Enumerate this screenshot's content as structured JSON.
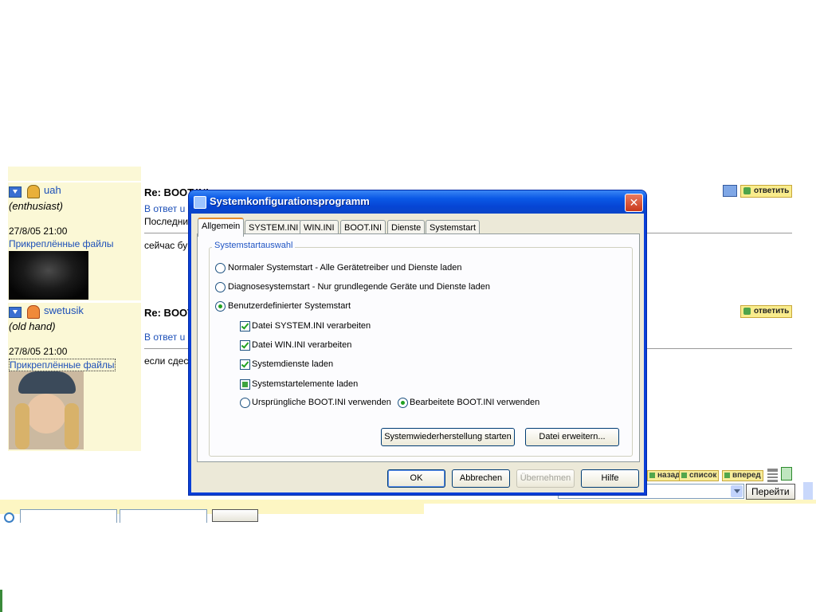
{
  "forum": {
    "posts": [
      {
        "username": "uah",
        "rank": "(enthusiast)",
        "date": "27/8/05 21:00",
        "files_label": "Прикреплённые файлы",
        "title": "Re: BOOT.INI",
        "reply": "В ответ u",
        "line1": "Последни",
        "text": "сейчас бу",
        "reply_button": "ответить"
      },
      {
        "username": "swetusik",
        "rank": "(old hand)",
        "date": "27/8/05 21:00",
        "files_label": "Прикреплённые файлы",
        "title": "Re: BOOT",
        "reply": "В ответ u",
        "text": "если сдес",
        "reply_button": "ответить"
      }
    ],
    "nav": {
      "back": "назад",
      "list": "список",
      "forward": "вперед"
    },
    "goto_button": "Перейти"
  },
  "dialog": {
    "title": "Systemkonfigurationsprogramm",
    "close": "✕",
    "tabs": [
      "Allgemein",
      "SYSTEM.INI",
      "WIN.INI",
      "BOOT.INI",
      "Dienste",
      "Systemstart"
    ],
    "active_tab": "Allgemein",
    "group_label": "Systemstartauswahl",
    "radio_options": [
      {
        "label": "Normaler Systemstart - Alle Gerätetreiber und Dienste laden",
        "selected": false
      },
      {
        "label": "Diagnosesystemstart - Nur grundlegende Geräte und Dienste laden",
        "selected": false
      },
      {
        "label": "Benutzerdefinierter Systemstart",
        "selected": true
      }
    ],
    "checkboxes": [
      {
        "label": "Datei SYSTEM.INI verarbeiten",
        "state": "checked"
      },
      {
        "label": "Datei WIN.INI verarbeiten",
        "state": "checked"
      },
      {
        "label": "Systemdienste laden",
        "state": "checked"
      },
      {
        "label": "Systemstartelemente laden",
        "state": "partial"
      }
    ],
    "boot_options": [
      {
        "label": "Ursprüngliche BOOT.INI verwenden",
        "selected": false
      },
      {
        "label": "Bearbeitete BOOT.INI verwenden",
        "selected": true
      }
    ],
    "restore_button": "Systemwiederherstellung starten",
    "extend_button": "Datei erweitern...",
    "ok": "OK",
    "cancel": "Abbrechen",
    "apply": "Übernehmen",
    "help": "Hilfe"
  }
}
